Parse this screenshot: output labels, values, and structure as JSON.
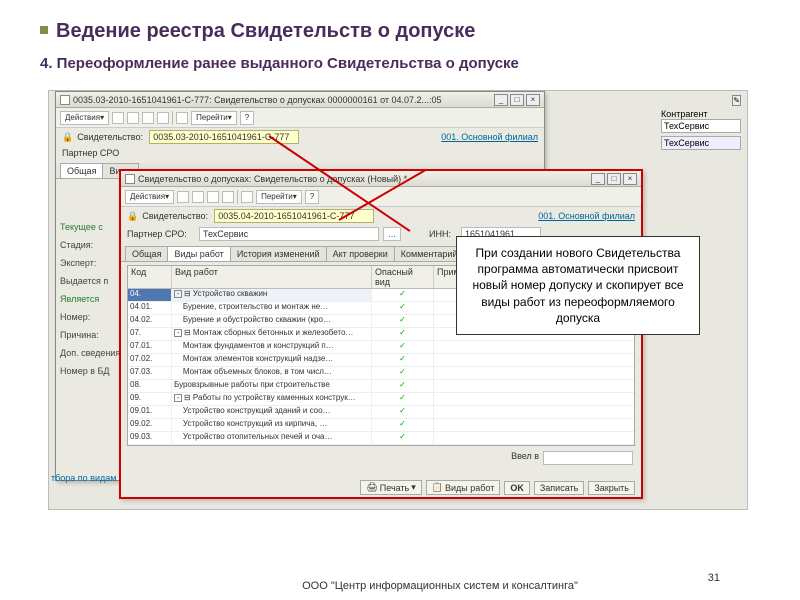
{
  "title": "Ведение реестра Свидетельств о допуске",
  "subtitle": "4. Переоформление ранее выданного Свидетельства о допуске",
  "window1": {
    "title": "0035.03-2010-1651041961-С-777: Свидетельство о допусках 0000000161 от 04.07.2...:05",
    "actions_label": "Действия",
    "goto_label": "Перейти",
    "cert_label": "Свидетельство:",
    "cert_value": "0035.03-2010-1651041961-C-777",
    "branch": "001. Основной филиал",
    "partner_label": "Партнер СРО",
    "tab_general": "Общая",
    "tab_types": "Виды"
  },
  "side": {
    "current": "Текущее с",
    "stage": "Стадия:",
    "expert": "Эксперт:",
    "issued": "Выдается п",
    "is": "Является",
    "number": "Номер:",
    "reason": "Причина:",
    "extra": "Доп. сведения",
    "db": "Номер в БД"
  },
  "right": {
    "contragent": "Контрагент",
    "tech": "ТехСервис",
    "tech2": "ТехСервис"
  },
  "window2": {
    "title": "Свидетельство о допусках: Свидетельство о допусках (Новый) *",
    "actions_label": "Действия",
    "goto_label": "Перейти",
    "cert_label": "Свидетельство:",
    "cert_value": "0035.04-2010-1651041961-C-777",
    "branch": "001. Основной филиал",
    "partner_label": "Партнер СРО:",
    "partner_value": "ТехСервис",
    "inn_label": "ИНН:",
    "inn_value": "1651041961",
    "tabs": [
      "Общая",
      "Виды работ",
      "История изменений",
      "Акт проверки",
      "Комментарий"
    ],
    "grid_headers": {
      "code": "Код",
      "work": "Вид работ",
      "danger": "Опасный вид",
      "note": "Примечание"
    },
    "rows": [
      {
        "code": "04.",
        "work": "⊟ Устройство скважин",
        "tree": "-",
        "check": "✓"
      },
      {
        "code": "04.01.",
        "work": "Бурение, строительство и монтаж не…",
        "check": "✓",
        "indent": 1
      },
      {
        "code": "04.02.",
        "work": "Бурение и обустройство скважин (кро…",
        "check": "✓",
        "indent": 1
      },
      {
        "code": "07.",
        "work": "⊟ Монтаж сборных бетонных и железобето…",
        "tree": "-",
        "check": "✓"
      },
      {
        "code": "07.01.",
        "work": "Монтаж фундаментов и конструкций п…",
        "check": "✓",
        "indent": 1
      },
      {
        "code": "07.02.",
        "work": "Монтаж элементов конструкций надзе…",
        "check": "✓",
        "indent": 1
      },
      {
        "code": "07.03.",
        "work": "Монтаж объемных блоков, в том числ…",
        "check": "✓",
        "indent": 1
      },
      {
        "code": "08.",
        "work": "Буровзрывные работы при строительстве",
        "check": "✓"
      },
      {
        "code": "09.",
        "work": "⊟ Работы по устройству каменных конструк…",
        "tree": "-",
        "check": "✓"
      },
      {
        "code": "09.01.",
        "work": "Устройство конструкций зданий и соо…",
        "check": "✓",
        "indent": 1
      },
      {
        "code": "09.02.",
        "work": "Устройство конструкций из кирпича, …",
        "check": "✓",
        "indent": 1
      },
      {
        "code": "09.03.",
        "work": "Устройство отопительных печей и оча…",
        "check": "✓",
        "indent": 1
      }
    ],
    "entered_label": "Ввел в",
    "buttons": {
      "print": "Печать",
      "types": "Виды работ",
      "ok": "OK",
      "save": "Записать",
      "close": "Закрыть"
    }
  },
  "callout": "При создании нового Свидетельства программа автоматически присвоит новый номер допуску и скопирует все виды работ из переоформляемого допуска",
  "bottom_filter": "тбора по видам",
  "footer": "ООО \"Центр информационных систем и консалтинга\"",
  "page": "31"
}
